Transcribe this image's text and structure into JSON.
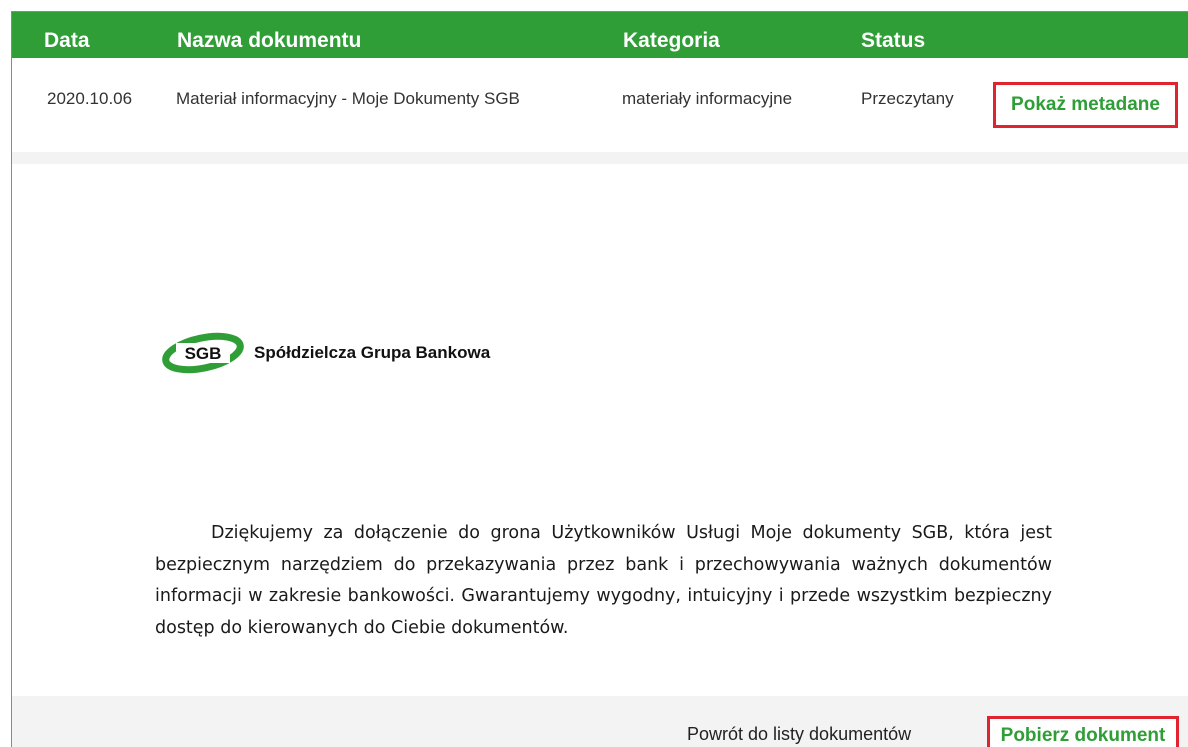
{
  "table": {
    "headers": {
      "date": "Data",
      "name": "Nazwa dokumentu",
      "category": "Kategoria",
      "status": "Status"
    },
    "rows": [
      {
        "date": "2020.10.06",
        "name": "Materiał informacyjny - Moje Dokumenty SGB",
        "category": "materiały informacyjne",
        "status": "Przeczytany",
        "action_label": "Pokaż metadane"
      }
    ]
  },
  "document": {
    "logo_abbr": "SGB",
    "logo_text": "Spółdzielcza Grupa Bankowa",
    "body": "Dziękujemy za dołączenie do grona Użytkowników Usługi Moje dokumenty SGB, która jest bezpiecznym narzędziem do przekazywania przez bank i przechowywania ważnych dokumentów informacji w zakresie bankowości. Gwarantujemy wygodny, intuicyjny i przede wszystkim bezpieczny dostęp do kierowanych do Ciebie dokumentów."
  },
  "footer": {
    "back_label": "Powrót do listy dokumentów",
    "download_label": "Pobierz dokument"
  },
  "colors": {
    "accent_green": "#2f9e36",
    "highlight_red": "#e0242f"
  }
}
